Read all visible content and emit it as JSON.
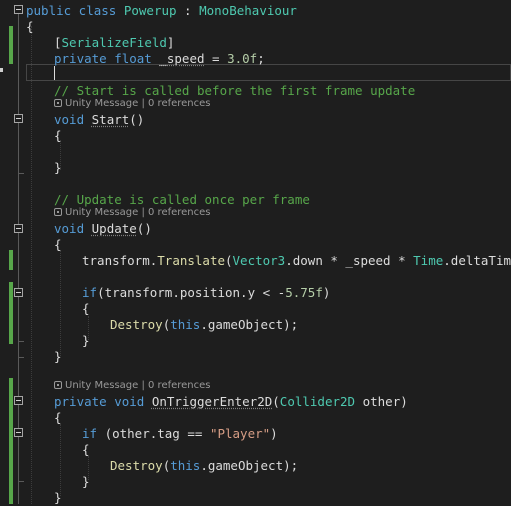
{
  "editor": {
    "lines": {
      "l1": {
        "kw": "public class ",
        "cls": "Powerup",
        "rest": " : ",
        "base": "MonoBehaviour"
      },
      "l2": "{",
      "l3": {
        "attr_open": "[",
        "attr": "SerializeField",
        "attr_close": "]"
      },
      "l4": {
        "kw": "private float ",
        "name": "_speed",
        "eq": " = ",
        "num": "3.0f",
        "end": ";"
      },
      "l5_comment": "// Start is called before the first frame update",
      "l6": {
        "kw": "void ",
        "name": "Start",
        "rest": "()"
      },
      "l7": "{",
      "l8": "}",
      "l9_comment": "// Update is called once per frame",
      "l10": {
        "kw": "void ",
        "name": "Update",
        "rest": "()"
      },
      "l11": "{",
      "l12": {
        "a": "transform.",
        "fn": "Translate",
        "b": "(",
        "cls": "Vector3",
        "c": ".down * _speed * ",
        "cls2": "Time",
        "d": ".deltaTime);"
      },
      "l13": {
        "kw": "if",
        "a": "(transform.position.y < -",
        "num": "5.75f",
        "b": ")"
      },
      "l14": "{",
      "l15": {
        "fn": "Destroy",
        "a": "(",
        "kw": "this",
        "b": ".gameObject);"
      },
      "l16": "}",
      "l17": "}",
      "l18": {
        "kw": "private void ",
        "name": "OnTriggerEnter2D",
        "a": "(",
        "cls": "Collider2D",
        "b": " other)"
      },
      "l19": "{",
      "l20": {
        "kw": "if ",
        "a": "(other.tag == ",
        "str": "\"Player\"",
        "b": ")"
      },
      "l21": "{",
      "l22": {
        "fn": "Destroy",
        "a": "(",
        "kw": "this",
        "b": ".gameObject);"
      },
      "l23": "}",
      "l24": "}"
    },
    "codelens": {
      "start": "Unity Message | 0 references",
      "update": "Unity Message | 0 references",
      "trigger": "Unity Message | 0 references"
    }
  },
  "colors": {
    "background": "#1e1e1e",
    "keyword": "#569cd6",
    "type": "#4ec9b0",
    "comment": "#57a64a",
    "string": "#d69d85",
    "number": "#b5cea8",
    "method": "#dcdcaa",
    "change_bar": "#57a64a"
  }
}
